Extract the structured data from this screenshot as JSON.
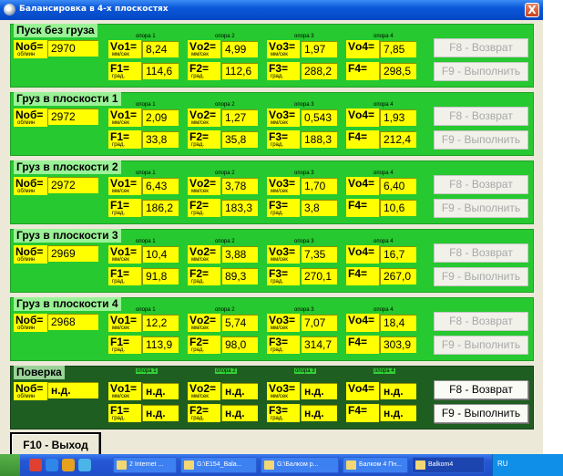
{
  "window": {
    "title": "Балансировка в 4-х плоскостях",
    "close_label": "X"
  },
  "labels": {
    "n": "Nоб=",
    "n_unit": "об/мин",
    "v1": "Vо1=",
    "v2": "Vо2=",
    "v3": "Vо3=",
    "v4": "Vо4=",
    "v_unit": "мм/сек",
    "f1": "F1=",
    "f2": "F2=",
    "f3": "F3=",
    "f4": "F4=",
    "f_unit": "град.",
    "opora1": "опора 1",
    "opora2": "опора 2",
    "opora3": "опора 3",
    "opora4": "опора 4"
  },
  "buttons": {
    "back": "F8 - Возврат",
    "run": "F9 - Выполнить",
    "exit": "F10 - Выход"
  },
  "sections": [
    {
      "title": "Пуск без груза",
      "n": "2970",
      "v1": "8,24",
      "v2": "4,99",
      "v3": "1,97",
      "v4": "7,85",
      "f1": "114,6",
      "f2": "112,6",
      "f3": "288,2",
      "f4": "298,5"
    },
    {
      "title": "Груз в плоскости 1",
      "n": "2972",
      "v1": "2,09",
      "v2": "1,27",
      "v3": "0,543",
      "v4": "1,93",
      "f1": "33,8",
      "f2": "35,8",
      "f3": "188,3",
      "f4": "212,4"
    },
    {
      "title": "Груз в плоскости 2",
      "n": "2972",
      "v1": "6,43",
      "v2": "3,78",
      "v3": "1,70",
      "v4": "6,40",
      "f1": "186,2",
      "f2": "183,3",
      "f3": "3,8",
      "f4": "10,6"
    },
    {
      "title": "Груз в плоскости 3",
      "n": "2969",
      "v1": "10,4",
      "v2": "3,88",
      "v3": "7,35",
      "v4": "16,7",
      "f1": "91,8",
      "f2": "89,3",
      "f3": "270,1",
      "f4": "267,0"
    },
    {
      "title": "Груз в плоскости 4",
      "n": "2968",
      "v1": "12,2",
      "v2": "5,74",
      "v3": "7,07",
      "v4": "18,4",
      "f1": "113,9",
      "f2": "98,0",
      "f3": "314,7",
      "f4": "303,9"
    },
    {
      "title": "Поверка",
      "n": "н.д.",
      "v1": "н.д.",
      "v2": "н.д.",
      "v3": "н.д.",
      "v4": "н.д.",
      "f1": "н.д.",
      "f2": "н.д.",
      "f3": "н.д.",
      "f4": "н.д."
    }
  ],
  "taskbar": {
    "items": [
      "2 Internet ...",
      "G:\\E154_Bala...",
      "G:\\Балком р...",
      "Балком 4 Пн...",
      "Balkom4"
    ],
    "lang": "RU"
  },
  "colors": {
    "section_bg": "#26c92f",
    "verify_bg": "#1f5e21",
    "field_bg": "#ffff00"
  }
}
